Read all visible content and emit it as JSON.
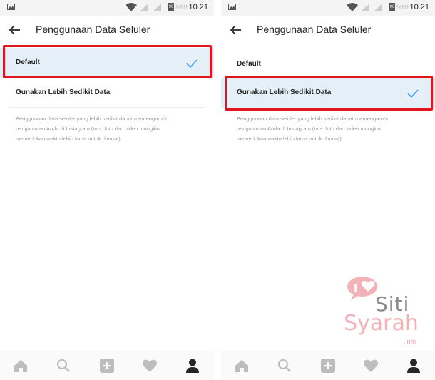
{
  "status_bar": {
    "battery": "96",
    "battery_pct": "96%",
    "time": "10.21"
  },
  "screen": {
    "title": "Penggunaan Data Seluler",
    "options": [
      {
        "label": "Default"
      },
      {
        "label": "Gunakan Lebih Sedikit Data"
      }
    ],
    "description_lines": [
      "Penggunaan data seluler yang lebih sedikit dapat memengaruhi",
      "pengalaman Anda di Instagram (mis: foto dan video mungkin",
      "memerlukan waktu lebih lama untuk dimuat)."
    ]
  },
  "left_screen": {
    "selected_option": "Default"
  },
  "right_screen": {
    "selected_option": "Gunakan Lebih Sedikit Data"
  },
  "colors": {
    "selected_bg": "#e4eff8",
    "check": "#3897f0",
    "highlight": "#e0161e"
  },
  "bottom_nav": [
    "home-icon",
    "search-icon",
    "add-icon",
    "heart-icon",
    "profile-icon"
  ],
  "watermark": {
    "logo_letter": "I",
    "line1": "Siti",
    "line2": "Syarah",
    "suffix": ".info"
  }
}
